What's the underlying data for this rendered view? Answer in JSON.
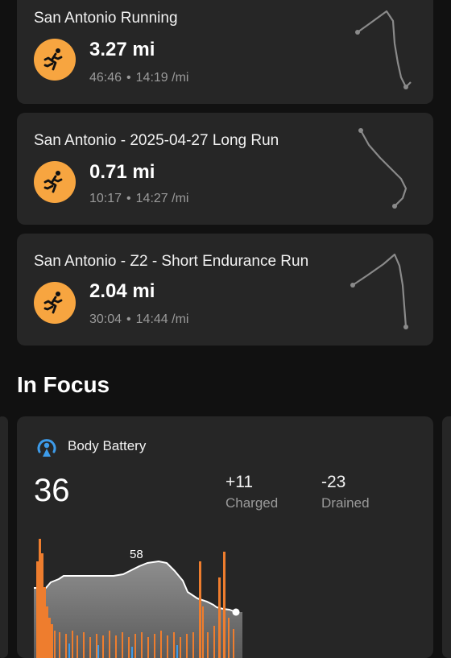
{
  "activities": [
    {
      "title": "San Antonio Running",
      "distance": "3.27 mi",
      "duration": "46:46",
      "separator": "•",
      "pace": "14:19 /mi",
      "icon": "running-icon"
    },
    {
      "title": "San Antonio - 2025-04-27 Long Run",
      "distance": "0.71 mi",
      "duration": "10:17",
      "separator": "•",
      "pace": "14:27 /mi",
      "icon": "running-icon"
    },
    {
      "title": "San Antonio - Z2 - Short Endurance Run",
      "distance": "2.04 mi",
      "duration": "30:04",
      "separator": "•",
      "pace": "14:44 /mi",
      "icon": "running-icon"
    }
  ],
  "in_focus": {
    "title": "In Focus",
    "body_battery": {
      "title": "Body Battery",
      "icon": "body-battery-icon",
      "value": "36",
      "charged_value": "+11",
      "charged_label": "Charged",
      "drained_value": "-23",
      "drained_label": "Drained",
      "peak_label": "58"
    }
  },
  "colors": {
    "background": "#111111",
    "card": "#262626",
    "activity_orange": "#f7a540",
    "battery_blue": "#3d9be9",
    "stress_orange": "#ee7d2e",
    "muted_text": "#9a9a9a"
  }
}
